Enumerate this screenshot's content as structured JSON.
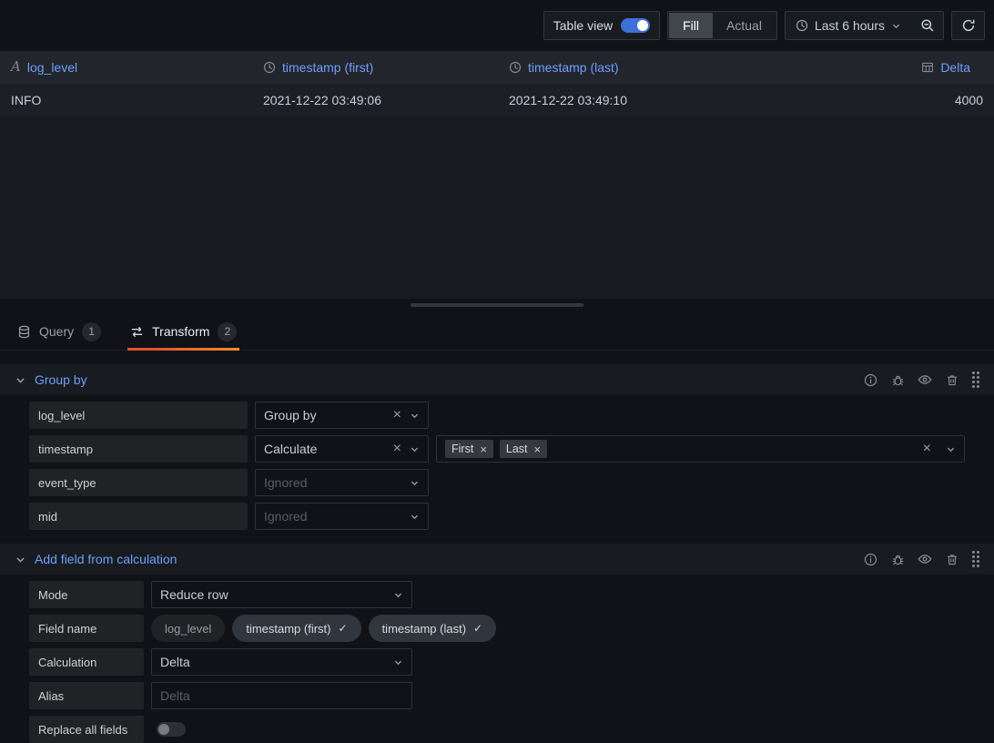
{
  "topbar": {
    "table_view_label": "Table view",
    "fill_label": "Fill",
    "actual_label": "Actual",
    "time_range": "Last 6 hours"
  },
  "table": {
    "headers": [
      "log_level",
      "timestamp (first)",
      "timestamp (last)",
      "Delta"
    ],
    "row": {
      "log_level": "INFO",
      "timestamp_first": "2021-12-22 03:49:06",
      "timestamp_last": "2021-12-22 03:49:10",
      "delta": "4000"
    }
  },
  "tabs": {
    "query_label": "Query",
    "query_badge": "1",
    "transform_label": "Transform",
    "transform_badge": "2"
  },
  "group_by": {
    "title": "Group by",
    "rows": [
      {
        "field": "log_level",
        "value": "Group by"
      },
      {
        "field": "timestamp",
        "value": "Calculate",
        "tags": [
          "First",
          "Last"
        ]
      },
      {
        "field": "event_type",
        "value": "Ignored"
      },
      {
        "field": "mid",
        "value": "Ignored"
      }
    ]
  },
  "add_field": {
    "title": "Add field from calculation",
    "mode_label": "Mode",
    "mode_value": "Reduce row",
    "field_name_label": "Field name",
    "pills": [
      {
        "label": "log_level",
        "selected": false
      },
      {
        "label": "timestamp (first)",
        "selected": true
      },
      {
        "label": "timestamp (last)",
        "selected": true
      }
    ],
    "calculation_label": "Calculation",
    "calculation_value": "Delta",
    "alias_label": "Alias",
    "alias_placeholder": "Delta",
    "replace_label": "Replace all fields"
  },
  "glyphs": {
    "close": "×",
    "check": "✓",
    "string_field": "A"
  }
}
